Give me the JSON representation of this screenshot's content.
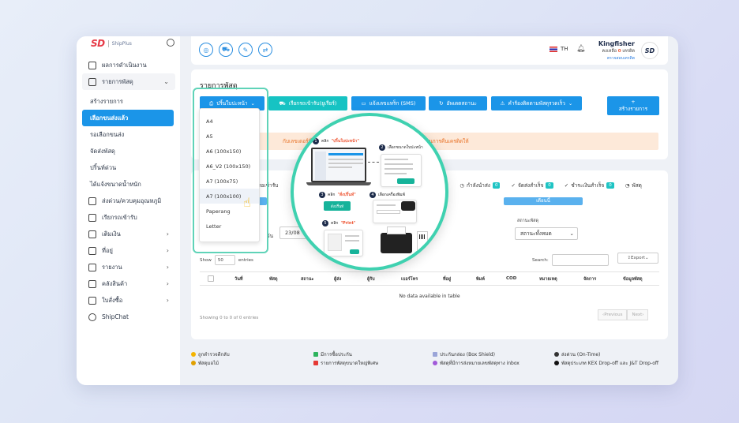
{
  "app": {
    "logo_text": "SD",
    "logo_sub": "ShipPlus",
    "brand_color": "#1b95e8",
    "accent_teal": "#16c3c3"
  },
  "sidebar": {
    "items": [
      {
        "label": "ผลการดำเนินงาน",
        "icon": "home-icon"
      },
      {
        "label": "รายการพัสดุ",
        "icon": "box-icon",
        "expanded": true
      }
    ],
    "sub_items": [
      {
        "label": "สร้างรายการ"
      },
      {
        "label": "เลือกขนส่งแล้ว",
        "active": true
      },
      {
        "label": "รอเลือกขนส่ง"
      },
      {
        "label": "จัดส่งพัสดุ"
      },
      {
        "label": "ปริ้นท์ด่วน"
      },
      {
        "label": "ได้แจ้งขนาดน้ำหนัก"
      }
    ],
    "more_items": [
      {
        "label": "ส่งด่วน/ควบคุมอุณหภูมิ",
        "icon": "truck-icon"
      },
      {
        "label": "เรียกรถเข้ารับ",
        "icon": "car-icon"
      },
      {
        "label": "เติมเงิน",
        "icon": "wallet-icon",
        "chevron": true
      },
      {
        "label": "ที่อยู่",
        "icon": "map-icon",
        "chevron": true
      },
      {
        "label": "รายงาน",
        "icon": "report-icon",
        "chevron": true
      },
      {
        "label": "คลังสินค้า",
        "icon": "store-icon",
        "chevron": true
      },
      {
        "label": "ใบสั่งซื้อ",
        "icon": "receipt-icon",
        "chevron": true
      },
      {
        "label": "ShipChat",
        "icon": "chat-icon"
      }
    ]
  },
  "topbar": {
    "lang": "TH",
    "user_name": "Kingfisher",
    "credit_label": "คงเหลือ",
    "credit_value": "0",
    "credit_unit": "เครดิต",
    "credit_link": "ตรวจสอบเครดิต"
  },
  "main": {
    "page_title": "รายการพัสดุ",
    "buttons": {
      "print_label": "ปริ้นใบปะหน้า",
      "pickup_label": "เรียกรถเข้ารับ(ยูเรียร์)",
      "sms_label": "แจ้งเลขแทร็ก (SMS)",
      "update_label": "อัพเดตสถานะ",
      "claim_label": "คำร้องติดตามพัสดุรวดเร็ว",
      "create_label": "สร้างรายการ"
    },
    "warning_text": "กับเลขเตอร์ที่อยู่ในสถานะ ... และ ยกเลิกรายการ เพื่อให้ระบบดำเนินการคืนเครดิตให้",
    "dropdown_options": [
      "A4",
      "A5",
      "A6 (100x150)",
      "A6_V2 (100x150)",
      "A7 (100x75)",
      "A7 (100x100)",
      "Paperang",
      "Letter"
    ],
    "highlighted_option": "A7 (100x100)"
  },
  "list": {
    "tabs": [
      {
        "label": "รอเข้ารับ"
      },
      {
        "label": "กำลังนำส่ง",
        "count": "0"
      },
      {
        "label": "จัดส่งสำเร็จ",
        "count": "0"
      },
      {
        "label": "ชำระเงินสำเร็จ",
        "count": "0"
      },
      {
        "label": "พัสดุ"
      }
    ],
    "strip_label": "เดือนนี้",
    "date_prefix": "วัน",
    "date_value": "23/08",
    "status_caption": "สถานะพัสดุ",
    "status_select": "สถานะทั้งหมด",
    "show_label": "Show",
    "show_value": "50",
    "entries_label": "entries",
    "search_label": "Search:",
    "export_label": "Export",
    "columns": [
      "วันที่",
      "พัสดุ",
      "สถานะ",
      "ผู้ส่ง",
      "ผู้รับ",
      "เบอร์โทร",
      "ที่อยู่",
      "พิมพ์",
      "COD",
      "หมายเหตุ",
      "จัดการ",
      "ข้อมูลพัสดุ"
    ],
    "empty_text": "No data available in table",
    "showing_text": "Showing 0 to 0 of 0 entries",
    "prev_label": "Previous",
    "next_label": "Next"
  },
  "footer": {
    "col1": [
      "ถูกตำรวจตีกลับ",
      "พัสดุมอไม้"
    ],
    "col2": [
      "มีการซื้อประกัน",
      "รายการพัสดุขนาดใหญ่พิเศษ"
    ],
    "col3": [
      "ประกันกล่อง (Box Shield)",
      "พัสดุที่มีการส่งหมายเลขพัสดุทาง inbox"
    ],
    "col4": [
      "ส่งด่วน (On-Time)",
      "พัสดุประเภท KEX Drop-off และ J&T Drop-off"
    ]
  },
  "zoom": {
    "step1_num": "1",
    "step1_text": "คลิก",
    "step1_quote": "\"ปริ้นใบปะหน้า\"",
    "step2_num": "2",
    "step2_text": "เลือกขนาดใบปะหน้า",
    "step3_num": "3",
    "step3_text": "คลิก",
    "step3_quote": "\"สั่งปริ้นท์\"",
    "step3_btn": "สั่งปริ้นท์",
    "step4_num": "4",
    "step4_text": "เลือกเครื่องพิมพ์",
    "step5_num": "5",
    "step5_text": "คลิก",
    "step5_quote": "\"Print\""
  }
}
